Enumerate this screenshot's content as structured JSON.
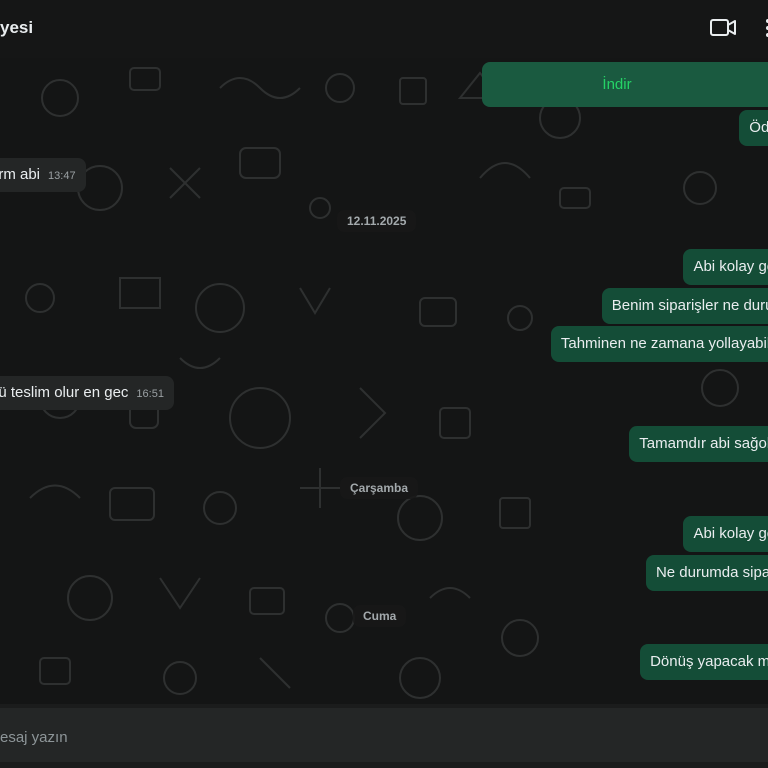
{
  "header": {
    "title": "yesi"
  },
  "download": {
    "label": "İndir"
  },
  "messages": {
    "out1": "Öded",
    "in1": {
      "text": "erm abi",
      "time": "13:47"
    },
    "date1": "12.11.2025",
    "out2": "Abi kolay gels",
    "out3": "Benim siparişler ne durum",
    "out4": "Tahminen ne zamana yollayabilirs",
    "in2": {
      "text": "nü teslim olur en gec",
      "time": "16:51"
    },
    "out5": "Tamamdır abi sağolas",
    "date2": "Çarşamba",
    "out6": "Abi kolay gels",
    "out7": "Ne durumda sipariş",
    "date3": "Cuma",
    "out8": "Dönüş yapacak mısı"
  },
  "composer": {
    "placeholder": "esaj yazın"
  },
  "icons": {
    "video": "video-camera-icon",
    "menu": "more-vertical-icon"
  },
  "colors": {
    "outgoing": "#144d37",
    "incoming": "#242626",
    "accent": "#25d366"
  }
}
